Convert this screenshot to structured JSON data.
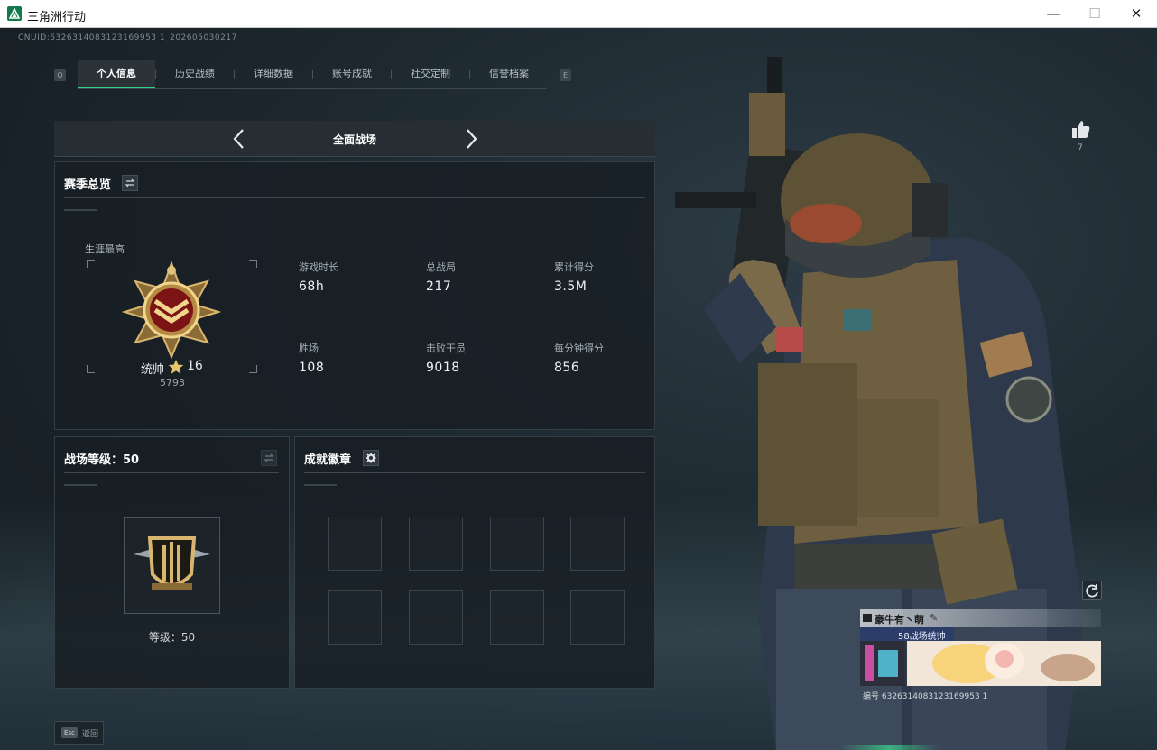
{
  "window": {
    "title": "三角洲行动",
    "minimize": "—",
    "maximize": "☐",
    "close": "✕"
  },
  "uid": "CNUID:6326314083123169953 1_202605030217",
  "tabs": {
    "prev_key": "Q",
    "next_key": "E",
    "items": [
      {
        "label": "个人信息",
        "active": true
      },
      {
        "label": "历史战绩",
        "active": false
      },
      {
        "label": "详细数据",
        "active": false
      },
      {
        "label": "账号成就",
        "active": false
      },
      {
        "label": "社交定制",
        "active": false
      },
      {
        "label": "信誉档案",
        "active": false
      }
    ]
  },
  "mode": {
    "label": "全面战场"
  },
  "season": {
    "title": "赛季总览",
    "career_label": "生涯最高",
    "rank_name": "统帅",
    "rank_level": "16",
    "rank_points": "5793",
    "stats": [
      {
        "label": "游戏时长",
        "value": "68h"
      },
      {
        "label": "总战局",
        "value": "217"
      },
      {
        "label": "累计得分",
        "value": "3.5M"
      },
      {
        "label": "胜场",
        "value": "108"
      },
      {
        "label": "击败干员",
        "value": "9018"
      },
      {
        "label": "每分钟得分",
        "value": "856"
      }
    ]
  },
  "battle_level": {
    "title": "战场等级：50",
    "level_text": "等级：50"
  },
  "achievements": {
    "title": "成就徽章"
  },
  "likes": {
    "count": "7"
  },
  "card": {
    "name": "豪牛有丶萌",
    "rank_text": "58战场统帅",
    "id_text": "编号 6326314083123169953 1"
  },
  "bottom": {
    "esc_key": "Esc",
    "esc_label": "返回"
  },
  "colors": {
    "accent": "#2fd38a",
    "bg": "#1d282f",
    "panel": "#181f24"
  }
}
